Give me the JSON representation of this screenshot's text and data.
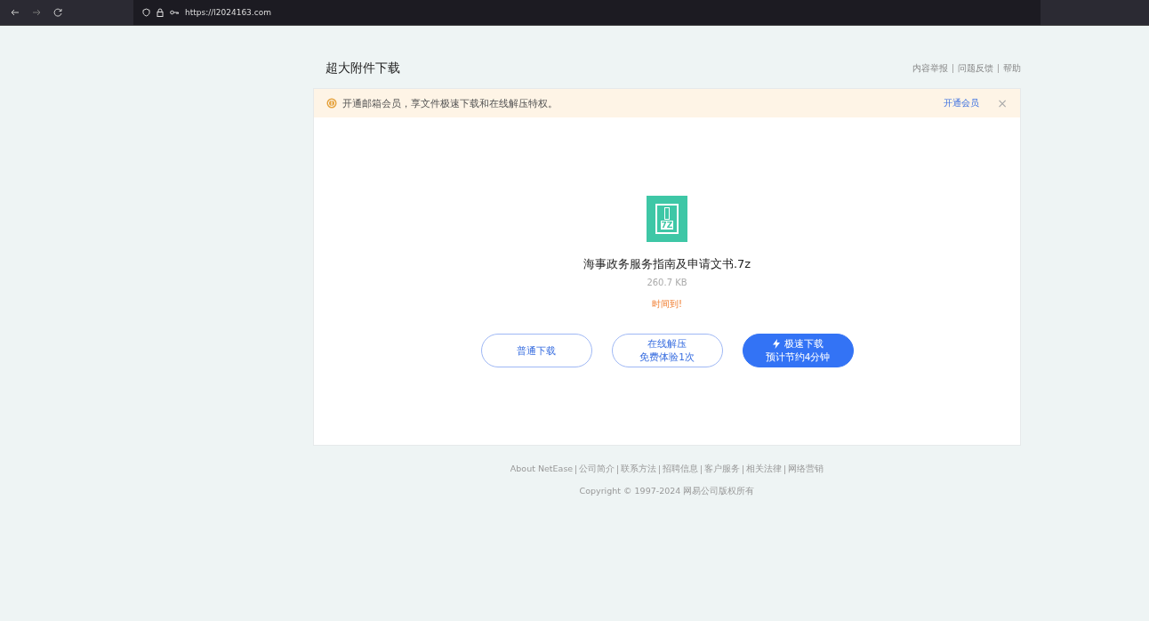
{
  "browser": {
    "url": "https://l2024163.com"
  },
  "page": {
    "title": "超大附件下载",
    "top_links": [
      "内容举报",
      "问题反馈",
      "帮助"
    ]
  },
  "banner": {
    "text": "开通邮箱会员，享文件极速下载和在线解压特权。",
    "link": "开通会员",
    "close": "×"
  },
  "file": {
    "name": "海事政务服务指南及申请文书.7z",
    "size": "260.7 KB",
    "status": "时间到!",
    "icon_label": "7Z"
  },
  "buttons": [
    {
      "kind": "outline",
      "label": "普通下载"
    },
    {
      "kind": "outline",
      "label": "在线解压",
      "sub": "免费体验1次"
    },
    {
      "kind": "primary",
      "label": "极速下载",
      "sub": "预计节约4分钟"
    }
  ],
  "footer": {
    "links": [
      "About NetEase",
      "公司简介",
      "联系方法",
      "招聘信息",
      "客户服务",
      "相关法律",
      "网络营销"
    ],
    "copyright": "Copyright © 1997-2024 网易公司版权所有"
  }
}
